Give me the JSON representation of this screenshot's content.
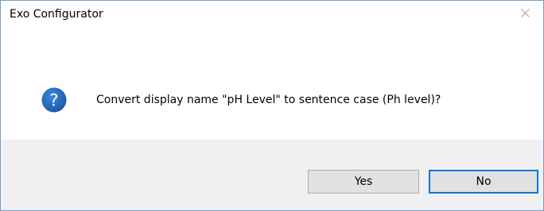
{
  "window": {
    "title": "Exo Configurator",
    "close_icon": "close-icon"
  },
  "dialog": {
    "icon": "question-icon",
    "icon_color": "#1f5fb0",
    "message": "Convert display name \"pH Level\" to sentence case (Ph level)?"
  },
  "buttons": {
    "yes_label": "Yes",
    "no_label": "No",
    "default_focus": "No",
    "focus_color": "#0078d7"
  }
}
